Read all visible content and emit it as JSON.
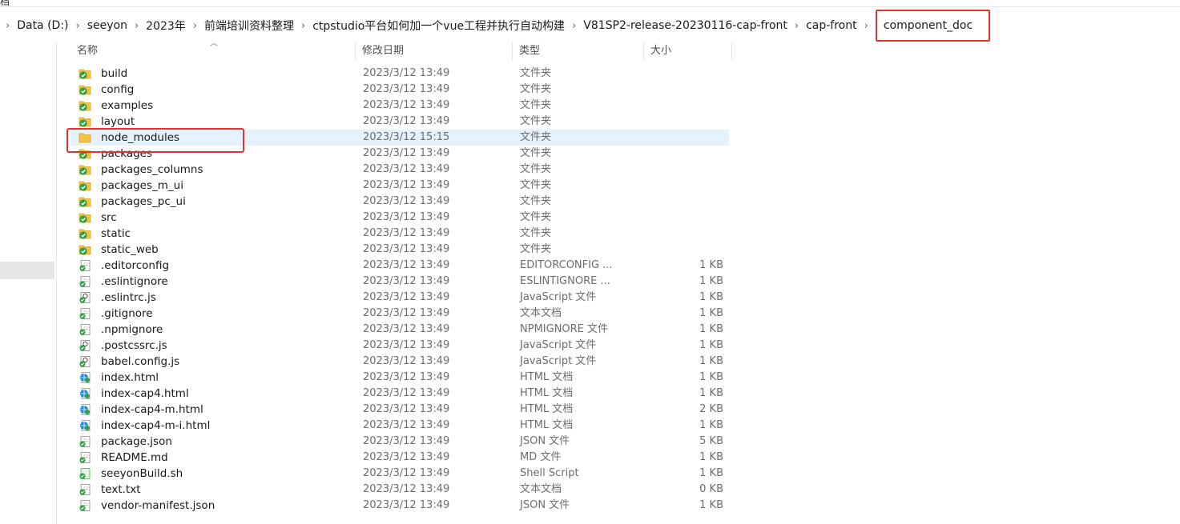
{
  "window": {
    "clipped_title": "档"
  },
  "breadcrumb": [
    "Data (D:)",
    "seeyon",
    "2023年",
    "前端培训资料整理",
    "ctpstudio平台如何加一个vue工程并执行自动构建",
    "V81SP2-release-20230116-cap-front",
    "cap-front",
    "component_doc"
  ],
  "columns": {
    "name": "名称",
    "date": "修改日期",
    "type": "类型",
    "size": "大小"
  },
  "colors": {
    "highlight": "#e8312f",
    "selection": "#e5f1fb",
    "folder": "#f5c242",
    "sync_green": "#2ea043"
  },
  "files": [
    {
      "name": "build",
      "date": "2023/3/12 13:49",
      "type": "文件夹",
      "size": "",
      "icon": "folder-synced-icon"
    },
    {
      "name": "config",
      "date": "2023/3/12 13:49",
      "type": "文件夹",
      "size": "",
      "icon": "folder-synced-icon"
    },
    {
      "name": "examples",
      "date": "2023/3/12 13:49",
      "type": "文件夹",
      "size": "",
      "icon": "folder-synced-icon"
    },
    {
      "name": "layout",
      "date": "2023/3/12 13:49",
      "type": "文件夹",
      "size": "",
      "icon": "folder-synced-icon"
    },
    {
      "name": "node_modules",
      "date": "2023/3/12 15:15",
      "type": "文件夹",
      "size": "",
      "icon": "folder-icon",
      "selected": true
    },
    {
      "name": "packages",
      "date": "2023/3/12 13:49",
      "type": "文件夹",
      "size": "",
      "icon": "folder-synced-icon"
    },
    {
      "name": "packages_columns",
      "date": "2023/3/12 13:49",
      "type": "文件夹",
      "size": "",
      "icon": "folder-synced-icon"
    },
    {
      "name": "packages_m_ui",
      "date": "2023/3/12 13:49",
      "type": "文件夹",
      "size": "",
      "icon": "folder-synced-icon"
    },
    {
      "name": "packages_pc_ui",
      "date": "2023/3/12 13:49",
      "type": "文件夹",
      "size": "",
      "icon": "folder-synced-icon"
    },
    {
      "name": "src",
      "date": "2023/3/12 13:49",
      "type": "文件夹",
      "size": "",
      "icon": "folder-synced-icon"
    },
    {
      "name": "static",
      "date": "2023/3/12 13:49",
      "type": "文件夹",
      "size": "",
      "icon": "folder-synced-icon"
    },
    {
      "name": "static_web",
      "date": "2023/3/12 13:49",
      "type": "文件夹",
      "size": "",
      "icon": "folder-synced-icon"
    },
    {
      "name": ".editorconfig",
      "date": "2023/3/12 13:49",
      "type": "EDITORCONFIG ...",
      "size": "1 KB",
      "icon": "file-synced-icon"
    },
    {
      "name": ".eslintignore",
      "date": "2023/3/12 13:49",
      "type": "ESLINTIGNORE ...",
      "size": "1 KB",
      "icon": "file-synced-icon"
    },
    {
      "name": ".eslintrc.js",
      "date": "2023/3/12 13:49",
      "type": "JavaScript 文件",
      "size": "1 KB",
      "icon": "script-file-icon"
    },
    {
      "name": ".gitignore",
      "date": "2023/3/12 13:49",
      "type": "文本文档",
      "size": "1 KB",
      "icon": "file-synced-icon"
    },
    {
      "name": ".npmignore",
      "date": "2023/3/12 13:49",
      "type": "NPMIGNORE 文件",
      "size": "1 KB",
      "icon": "file-synced-icon"
    },
    {
      "name": ".postcssrc.js",
      "date": "2023/3/12 13:49",
      "type": "JavaScript 文件",
      "size": "1 KB",
      "icon": "script-file-icon"
    },
    {
      "name": "babel.config.js",
      "date": "2023/3/12 13:49",
      "type": "JavaScript 文件",
      "size": "1 KB",
      "icon": "script-file-icon"
    },
    {
      "name": "index.html",
      "date": "2023/3/12 13:49",
      "type": "HTML 文档",
      "size": "1 KB",
      "icon": "html-file-icon"
    },
    {
      "name": "index-cap4.html",
      "date": "2023/3/12 13:49",
      "type": "HTML 文档",
      "size": "1 KB",
      "icon": "html-file-icon"
    },
    {
      "name": "index-cap4-m.html",
      "date": "2023/3/12 13:49",
      "type": "HTML 文档",
      "size": "2 KB",
      "icon": "html-file-icon"
    },
    {
      "name": "index-cap4-m-i.html",
      "date": "2023/3/12 13:49",
      "type": "HTML 文档",
      "size": "1 KB",
      "icon": "html-file-icon"
    },
    {
      "name": "package.json",
      "date": "2023/3/12 13:49",
      "type": "JSON 文件",
      "size": "5 KB",
      "icon": "file-synced-icon"
    },
    {
      "name": "README.md",
      "date": "2023/3/12 13:49",
      "type": "MD 文件",
      "size": "1 KB",
      "icon": "file-synced-icon"
    },
    {
      "name": "seeyonBuild.sh",
      "date": "2023/3/12 13:49",
      "type": "Shell Script",
      "size": "1 KB",
      "icon": "shell-file-icon"
    },
    {
      "name": "text.txt",
      "date": "2023/3/12 13:49",
      "type": "文本文档",
      "size": "0 KB",
      "icon": "file-synced-icon"
    },
    {
      "name": "vendor-manifest.json",
      "date": "2023/3/12 13:49",
      "type": "JSON 文件",
      "size": "1 KB",
      "icon": "file-synced-icon"
    }
  ]
}
